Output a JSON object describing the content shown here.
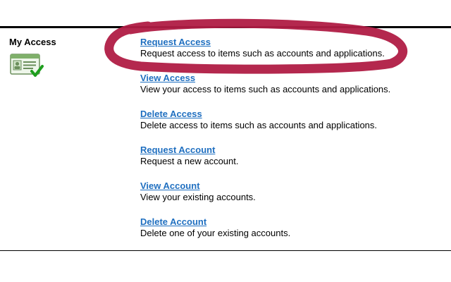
{
  "section": {
    "title": "My Access",
    "icon": "access-card-check-icon"
  },
  "items": [
    {
      "link": "Request Access",
      "description": "Request access to items such as accounts and applications."
    },
    {
      "link": "View Access",
      "description": "View your access to items such as accounts and applications."
    },
    {
      "link": "Delete Access",
      "description": "Delete access to items such as accounts and applications."
    },
    {
      "link": "Request Account",
      "description": "Request a new account."
    },
    {
      "link": "View Account",
      "description": "View your existing accounts."
    },
    {
      "link": "Delete Account",
      "description": "Delete one of your existing accounts."
    }
  ],
  "colors": {
    "link": "#1f6fc0",
    "annotation": "#b01c45"
  }
}
